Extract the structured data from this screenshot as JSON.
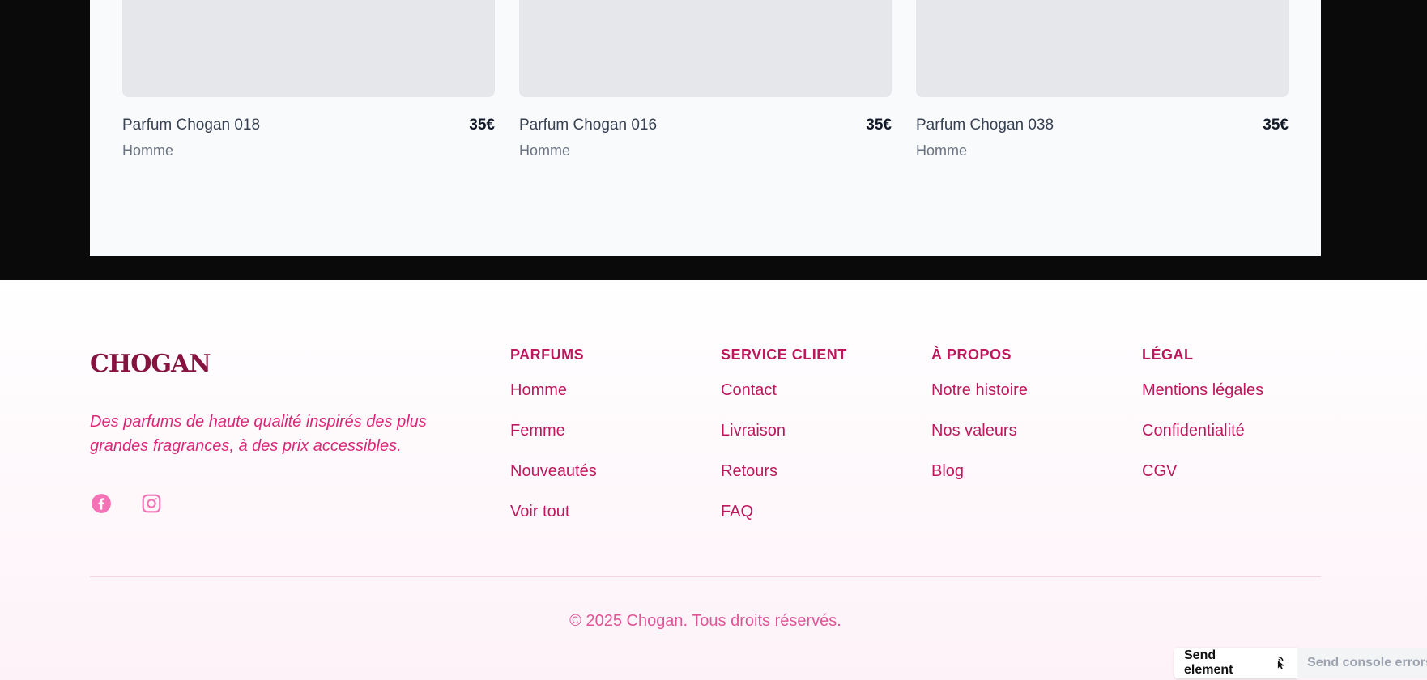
{
  "products": [
    {
      "name": "Parfum Chogan 018",
      "price": "35€",
      "category": "Homme"
    },
    {
      "name": "Parfum Chogan 016",
      "price": "35€",
      "category": "Homme"
    },
    {
      "name": "Parfum Chogan 038",
      "price": "35€",
      "category": "Homme"
    }
  ],
  "footer": {
    "brand": "CHOGAN",
    "tagline": "Des parfums de haute qualité inspirés des plus grandes fragrances, à des prix accessibles.",
    "socials": [
      "facebook-icon",
      "instagram-icon"
    ],
    "columns": [
      {
        "title": "PARFUMS",
        "links": [
          "Homme",
          "Femme",
          "Nouveautés",
          "Voir tout"
        ]
      },
      {
        "title": "SERVICE CLIENT",
        "links": [
          "Contact",
          "Livraison",
          "Retours",
          "FAQ"
        ]
      },
      {
        "title": "À PROPOS",
        "links": [
          "Notre histoire",
          "Nos valeurs",
          "Blog"
        ]
      },
      {
        "title": "LÉGAL",
        "links": [
          "Mentions légales",
          "Confidentialité",
          "CGV"
        ]
      }
    ],
    "copyright": "© 2025 Chogan. Tous droits réservés."
  },
  "devbar": {
    "send_element": "Send element",
    "send_console": "Send console errors"
  },
  "colors": {
    "accent": "#be185d",
    "brand": "#86123f",
    "tagline": "#db2777",
    "social": "#f472b6"
  }
}
